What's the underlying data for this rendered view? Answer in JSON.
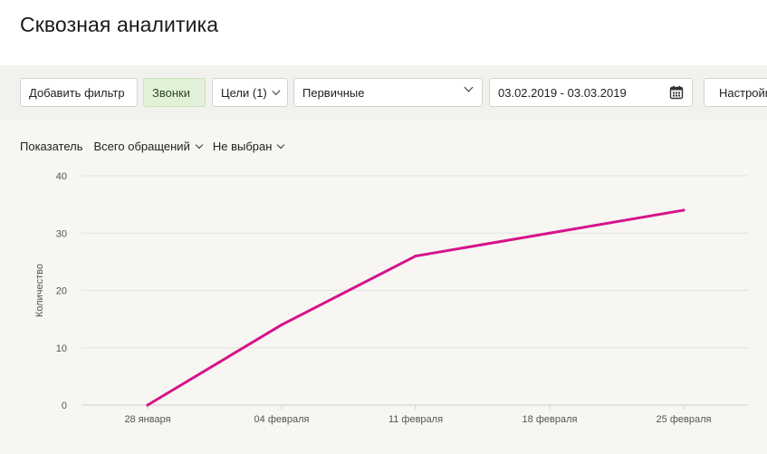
{
  "page": {
    "title": "Сквозная аналитика"
  },
  "toolbar": {
    "add_filter_label": "Добавить фильтр",
    "calls_tab_label": "Звонки",
    "goals_label": "Цели (1)",
    "type_select_value": "Первичные",
    "date_range_value": "03.02.2019 - 03.03.2019",
    "settings_label": "Настройки"
  },
  "indicator": {
    "label": "Показатель",
    "metric_value": "Всего обращений",
    "secondary_value": "Не выбран"
  },
  "colors": {
    "accent": "#d6138a",
    "active_tab_bg": "#e1f1d8"
  },
  "chart_data": {
    "type": "line",
    "categories": [
      "28 января",
      "04 февраля",
      "11 февраля",
      "18 февраля",
      "25 февраля"
    ],
    "series": [
      {
        "values": [
          0,
          14,
          26,
          30,
          34
        ]
      }
    ],
    "ylabel": "Количество",
    "ylim": [
      0,
      40
    ],
    "yticks": [
      0,
      10,
      20,
      30,
      40
    ],
    "grid": true
  }
}
